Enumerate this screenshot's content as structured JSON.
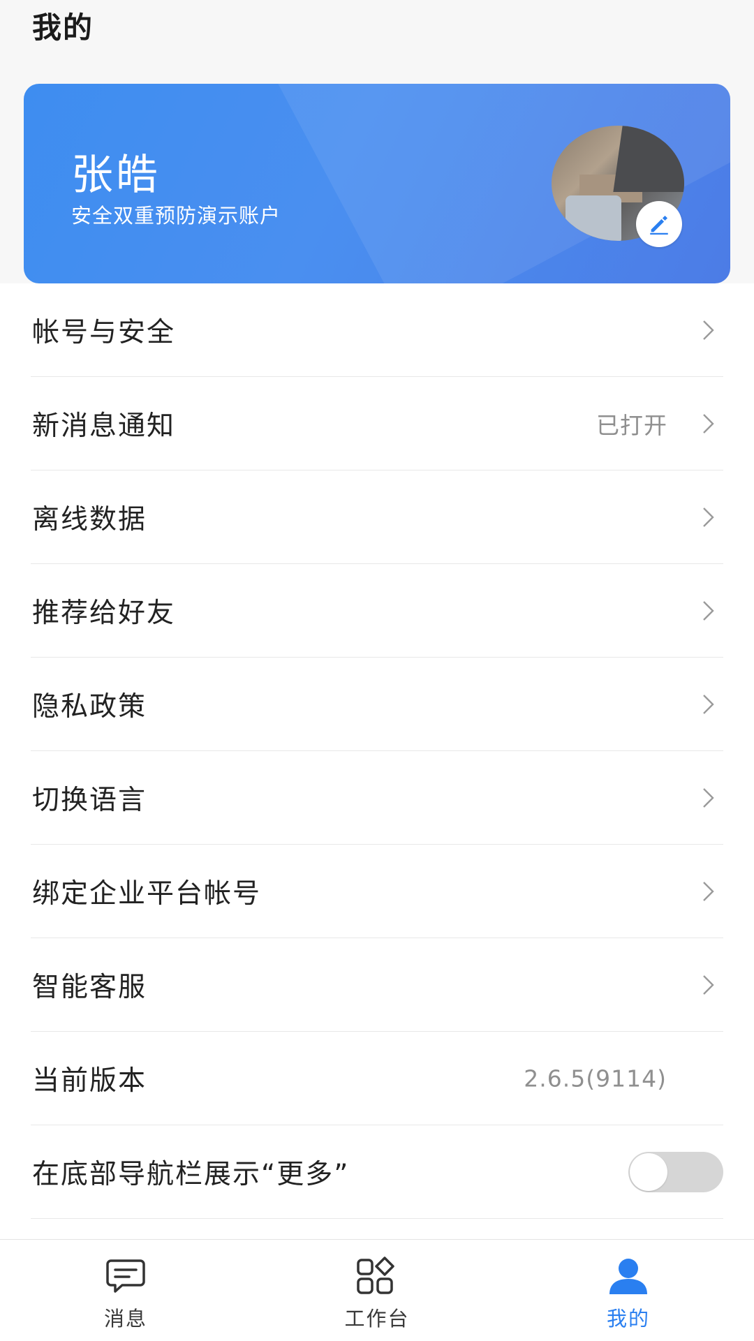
{
  "header": {
    "title": "我的"
  },
  "profile": {
    "name": "张皓",
    "subtitle": "安全双重预防演示账户",
    "edit_icon": "pencil-icon"
  },
  "menu": {
    "items": [
      {
        "label": "帐号与安全",
        "value": "",
        "type": "link"
      },
      {
        "label": "新消息通知",
        "value": "已打开",
        "type": "link"
      },
      {
        "label": "离线数据",
        "value": "",
        "type": "link"
      },
      {
        "label": "推荐给好友",
        "value": "",
        "type": "link"
      },
      {
        "label": "隐私政策",
        "value": "",
        "type": "link"
      },
      {
        "label": "切换语言",
        "value": "",
        "type": "link"
      },
      {
        "label": "绑定企业平台帐号",
        "value": "",
        "type": "link"
      },
      {
        "label": "智能客服",
        "value": "",
        "type": "link"
      },
      {
        "label": "当前版本",
        "value": "2.6.5(9114)",
        "type": "info"
      },
      {
        "label": "在底部导航栏展示“更多”",
        "value": "",
        "type": "toggle",
        "toggle_on": false
      }
    ]
  },
  "tabbar": {
    "tabs": [
      {
        "label": "消息",
        "icon": "message-icon",
        "active": false
      },
      {
        "label": "工作台",
        "icon": "workbench-icon",
        "active": false
      },
      {
        "label": "我的",
        "icon": "user-icon",
        "active": true
      }
    ]
  },
  "colors": {
    "accent": "#2a7ff0",
    "card_start": "#3e8df0",
    "card_end": "#4c7ce6"
  }
}
